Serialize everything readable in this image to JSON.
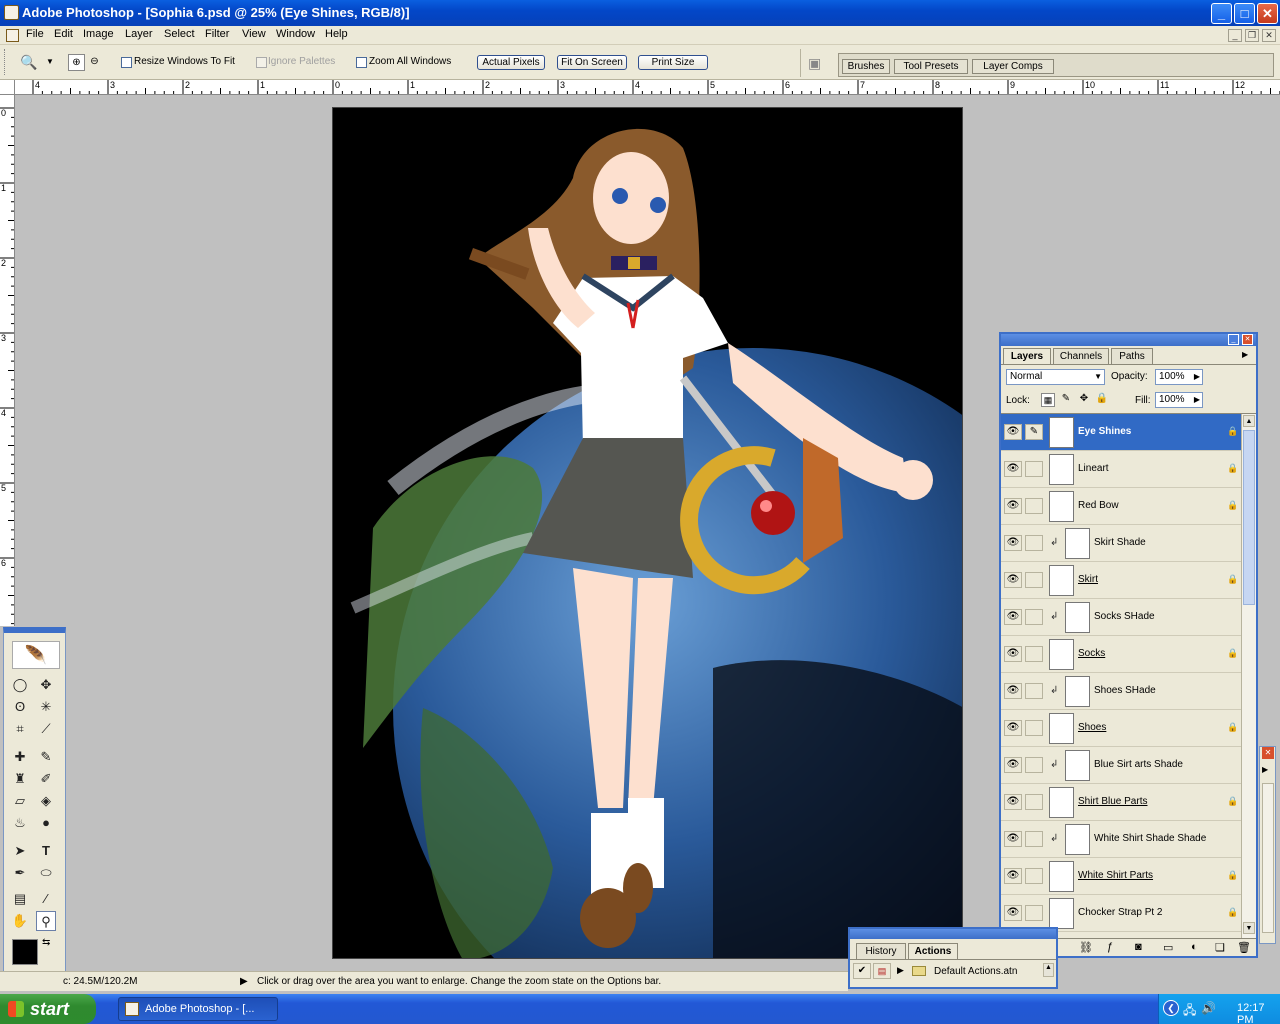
{
  "window": {
    "title": "Adobe Photoshop - [Sophia 6.psd @ 25% (Eye Shines, RGB/8)]",
    "minimize_label": "_",
    "maximize_label": "□",
    "close_label": "✕"
  },
  "menu": [
    "File",
    "Edit",
    "Image",
    "Layer",
    "Select",
    "Filter",
    "View",
    "Window",
    "Help"
  ],
  "options": {
    "resize_windows": "Resize Windows To Fit",
    "ignore_palettes": "Ignore Palettes",
    "zoom_all": "Zoom All Windows",
    "actual_pixels": "Actual Pixels",
    "fit_on_screen": "Fit On Screen",
    "print_size": "Print Size"
  },
  "palette_well": [
    "Brushes",
    "Tool Presets",
    "Layer Comps"
  ],
  "rulers": {
    "h_ticks": [
      "4",
      "3",
      "2",
      "1",
      "0",
      "1",
      "2",
      "3",
      "4",
      "5",
      "6",
      "7",
      "8",
      "9",
      "10",
      "11",
      "12"
    ],
    "v_ticks": [
      "0",
      "1",
      "2",
      "3",
      "4",
      "5",
      "6"
    ]
  },
  "layers_panel": {
    "tabs": [
      "Layers",
      "Channels",
      "Paths"
    ],
    "blend_mode": "Normal",
    "opacity_label": "Opacity:",
    "opacity_value": "100%",
    "lock_label": "Lock:",
    "fill_label": "Fill:",
    "fill_value": "100%",
    "layers": [
      {
        "name": "Eye Shines",
        "selected": true,
        "clipped": false,
        "underline": false
      },
      {
        "name": "Lineart",
        "selected": false,
        "clipped": false,
        "underline": false
      },
      {
        "name": "Red Bow",
        "selected": false,
        "clipped": false,
        "underline": false
      },
      {
        "name": "Skirt Shade",
        "selected": false,
        "clipped": true,
        "underline": false
      },
      {
        "name": "Skirt",
        "selected": false,
        "clipped": false,
        "underline": true
      },
      {
        "name": "Socks SHade",
        "selected": false,
        "clipped": true,
        "underline": false
      },
      {
        "name": "Socks",
        "selected": false,
        "clipped": false,
        "underline": true
      },
      {
        "name": "Shoes SHade",
        "selected": false,
        "clipped": true,
        "underline": false
      },
      {
        "name": "Shoes",
        "selected": false,
        "clipped": false,
        "underline": true
      },
      {
        "name": "Blue Sirt arts Shade",
        "selected": false,
        "clipped": true,
        "underline": false
      },
      {
        "name": "Shirt Blue Parts",
        "selected": false,
        "clipped": false,
        "underline": true
      },
      {
        "name": "White Shirt Shade Shade",
        "selected": false,
        "clipped": true,
        "underline": false
      },
      {
        "name": "White Shirt Parts",
        "selected": false,
        "clipped": false,
        "underline": true
      },
      {
        "name": "Chocker Strap Pt 2",
        "selected": false,
        "clipped": false,
        "underline": false
      }
    ]
  },
  "history_panel": {
    "tabs": [
      "History",
      "Actions"
    ],
    "set_name": "Default Actions.atn"
  },
  "status": {
    "doc_size": "c: 24.5M/120.2M",
    "hint": "Click or drag over the area you want to enlarge. Change the zoom state on the Options bar."
  },
  "taskbar": {
    "start": "start",
    "task": "Adobe Photoshop - [...",
    "clock": "12:17 PM"
  },
  "colors": {
    "xp_blue": "#0a5fe0",
    "selected_layer": "#316ac5",
    "start_green": "#2f8a2f"
  }
}
